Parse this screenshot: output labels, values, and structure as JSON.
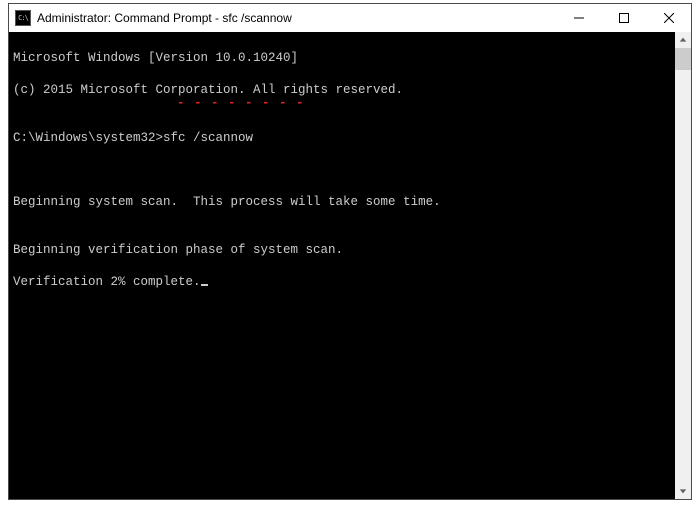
{
  "window": {
    "title": "Administrator: Command Prompt - sfc  /scannow",
    "icon_label": "C:\\"
  },
  "terminal": {
    "lines": [
      "Microsoft Windows [Version 10.0.10240]",
      "(c) 2015 Microsoft Corporation. All rights reserved.",
      "",
      "C:\\Windows\\system32>sfc /scannow",
      "",
      "",
      "Beginning system scan.  This process will take some time.",
      "",
      "Beginning verification phase of system scan.",
      "Verification 2% complete."
    ],
    "underline_marker": "- - - - - - - -"
  }
}
